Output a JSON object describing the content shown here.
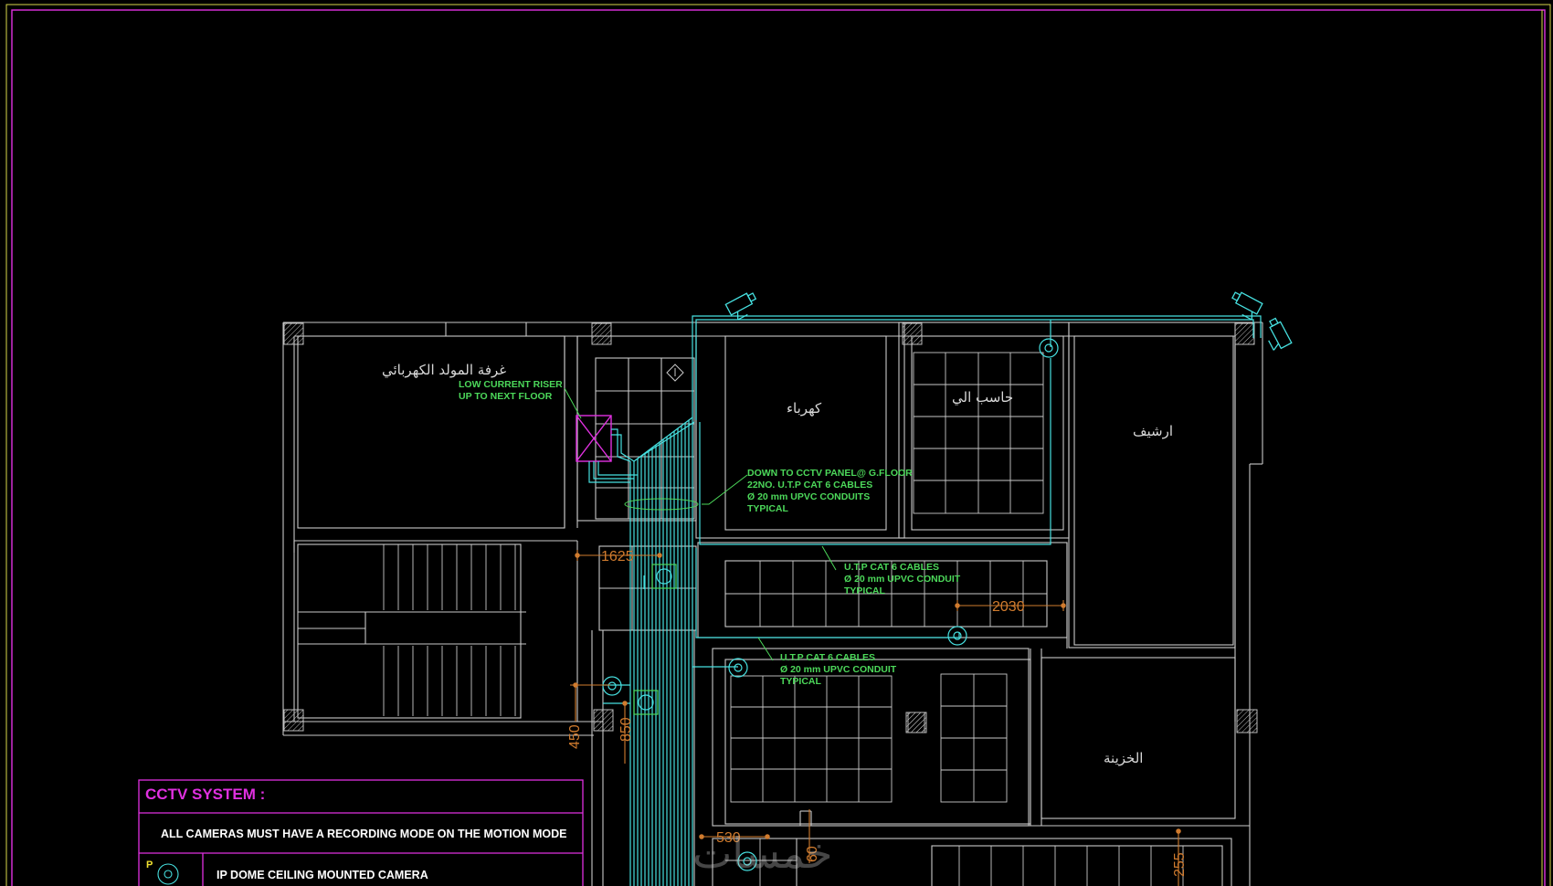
{
  "rooms": {
    "generator_room": "غرفة المولد الكهربائي",
    "electrical": "كهرباء",
    "computer": "حاسب الي",
    "archive": "ارشيف",
    "treasury": "الخزينة"
  },
  "notes": {
    "riser_line1": "LOW CURRENT RISER",
    "riser_line2": "UP TO NEXT FLOOR",
    "panel_line1": "DOWN TO CCTV PANEL@ G.FLOOR",
    "panel_line2": "22NO. U.T.P CAT 6 CABLES",
    "panel_line3": "Ø 20 mm UPVC CONDUITS",
    "panel_line4": "TYPICAL",
    "cable_a_line1": "U.T.P CAT 6 CABLES",
    "cable_a_line2": "Ø 20 mm UPVC CONDUIT",
    "cable_a_line3": "TYPICAL",
    "cable_b_line1": "U.T.P CAT 6 CABLES",
    "cable_b_line2": "Ø 20 mm UPVC CONDUIT",
    "cable_b_line3": "TYPICAL"
  },
  "dimensions": {
    "d1": "1625",
    "d2": "2030",
    "d3": "450",
    "d4": "850",
    "d5": "530",
    "d6": "60",
    "d7": "255"
  },
  "legend": {
    "title": "CCTV SYSTEM :",
    "rule": "ALL CAMERAS MUST HAVE A RECORDING MODE ON THE MOTION MODE",
    "item1_mark": "P",
    "item1_label": "IP DOME CEILING MOUNTED CAMERA"
  },
  "watermark": "خمسات",
  "colors": {
    "background": "#000000",
    "walls": "#c9c9c9",
    "cable": "#46e0e0",
    "annotation": "#4cd85a",
    "dimension": "#d07b2e",
    "border": "#e030e0"
  },
  "icons": {
    "camera_bullet": "cctv-bullet-camera-icon",
    "camera_dome": "ip-dome-camera-icon",
    "riser": "riser-shaft-icon",
    "column": "column-hatch-icon"
  }
}
